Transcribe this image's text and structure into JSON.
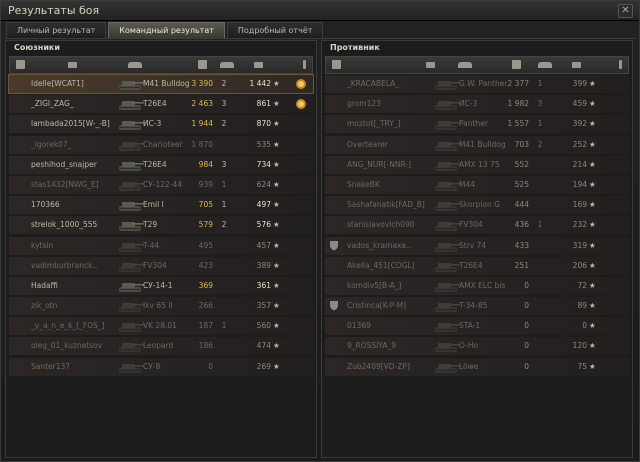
{
  "window": {
    "title": "Результаты боя",
    "close": "✕"
  },
  "tabs": [
    {
      "label": "Личный результат",
      "active": false
    },
    {
      "label": "Командный результат",
      "active": true
    },
    {
      "label": "Подробный отчёт",
      "active": false
    }
  ],
  "allies": {
    "title": "Союзники",
    "rows": [
      {
        "name": "Idelle[WCAT1]",
        "tank": "M41 Bulldog",
        "damage": "3 390",
        "kills": "2",
        "xp": "1 442",
        "medal": true,
        "mine": true,
        "dead": false
      },
      {
        "name": "_ZIGI_ZAG_",
        "tank": "T26E4",
        "damage": "2 463",
        "kills": "3",
        "xp": "861",
        "medal": true,
        "mine": false,
        "dead": false
      },
      {
        "name": "lambada2015[W-_-B]",
        "tank": "ИС-3",
        "damage": "1 944",
        "kills": "2",
        "xp": "870",
        "medal": false,
        "mine": false,
        "dead": false
      },
      {
        "name": "_lgorek07_",
        "tank": "Charioteer",
        "damage": "1 870",
        "kills": "",
        "xp": "535",
        "medal": false,
        "mine": false,
        "dead": true
      },
      {
        "name": "peshihod_snajper",
        "tank": "T26E4",
        "damage": "984",
        "kills": "3",
        "xp": "734",
        "medal": false,
        "mine": false,
        "dead": false
      },
      {
        "name": "stas1432[NWG_E]",
        "tank": "СУ-122-44",
        "damage": "939",
        "kills": "1",
        "xp": "624",
        "medal": false,
        "mine": false,
        "dead": true
      },
      {
        "name": "170366",
        "tank": "Emil I",
        "damage": "705",
        "kills": "1",
        "xp": "497",
        "medal": false,
        "mine": false,
        "dead": false
      },
      {
        "name": "strelok_1000_555",
        "tank": "T29",
        "damage": "579",
        "kills": "2",
        "xp": "576",
        "medal": false,
        "mine": false,
        "dead": false
      },
      {
        "name": "kytsin",
        "tank": "T-44",
        "damage": "495",
        "kills": "",
        "xp": "457",
        "medal": false,
        "mine": false,
        "dead": true
      },
      {
        "name": "vadimburbranck..",
        "tank": "FV304",
        "damage": "423",
        "kills": "",
        "xp": "389",
        "medal": false,
        "mine": false,
        "dead": true
      },
      {
        "name": "Hadaffi",
        "tank": "СУ-14-1",
        "damage": "369",
        "kills": "",
        "xp": "361",
        "medal": false,
        "mine": false,
        "dead": false
      },
      {
        "name": "zik_otn",
        "tank": "Ikv 65 II",
        "damage": "266",
        "kills": "",
        "xp": "357",
        "medal": false,
        "mine": false,
        "dead": true
      },
      {
        "name": "_y_a_n_e_k_[_FOS_]",
        "tank": "VK 28.01",
        "damage": "187",
        "kills": "1",
        "xp": "560",
        "medal": false,
        "mine": false,
        "dead": true
      },
      {
        "name": "oleg_01_kuznetsov",
        "tank": "Leopard",
        "damage": "186",
        "kills": "",
        "xp": "474",
        "medal": false,
        "mine": false,
        "dead": true
      },
      {
        "name": "Santer137",
        "tank": "СУ-8",
        "damage": "0",
        "kills": "",
        "xp": "269",
        "medal": false,
        "mine": false,
        "dead": true
      }
    ]
  },
  "enemies": {
    "title": "Противник",
    "rows": [
      {
        "name": "_KRACABELA_",
        "tank": "G.W. Panther",
        "damage": "2 377",
        "kills": "1",
        "xp": "399",
        "shield": false,
        "dead": true
      },
      {
        "name": "grom123",
        "tank": "ИС-3",
        "damage": "1 982",
        "kills": "3",
        "xp": "459",
        "shield": false,
        "dead": true
      },
      {
        "name": "moztot[_TRY_]",
        "tank": "Panther",
        "damage": "1 557",
        "kills": "1",
        "xp": "392",
        "shield": false,
        "dead": true
      },
      {
        "name": "Overtearer",
        "tank": "M41 Bulldog",
        "damage": "703",
        "kills": "2",
        "xp": "252",
        "shield": false,
        "dead": true
      },
      {
        "name": "ANG_NUR[-NNR-]",
        "tank": "AMX 13 75",
        "damage": "552",
        "kills": "",
        "xp": "214",
        "shield": false,
        "dead": true
      },
      {
        "name": "SnakeBK",
        "tank": "M44",
        "damage": "525",
        "kills": "",
        "xp": "194",
        "shield": false,
        "dead": true
      },
      {
        "name": "Sashafanatik[FAD_B]",
        "tank": "Skorpion G",
        "damage": "444",
        "kills": "",
        "xp": "169",
        "shield": false,
        "dead": true
      },
      {
        "name": "stanislavovich090",
        "tank": "FV304",
        "damage": "436",
        "kills": "1",
        "xp": "232",
        "shield": false,
        "dead": true
      },
      {
        "name": "vados_kramaxa..",
        "tank": "Strv 74",
        "damage": "433",
        "kills": "",
        "xp": "319",
        "shield": true,
        "dead": true
      },
      {
        "name": "Akella_451[COGL]",
        "tank": "T26E4",
        "damage": "251",
        "kills": "",
        "xp": "206",
        "shield": false,
        "dead": true
      },
      {
        "name": "komdiv5[B-A_]",
        "tank": "AMX ELC bis",
        "damage": "0",
        "kills": "",
        "xp": "72",
        "shield": false,
        "dead": true
      },
      {
        "name": "Cristinca[K-P-M]",
        "tank": "T-34-85",
        "damage": "0",
        "kills": "",
        "xp": "89",
        "shield": true,
        "dead": true
      },
      {
        "name": "01369",
        "tank": "STA-1",
        "damage": "0",
        "kills": "",
        "xp": "0",
        "shield": false,
        "dead": true
      },
      {
        "name": "9_ROSSIYA_9",
        "tank": "O-Ho",
        "damage": "0",
        "kills": "",
        "xp": "120",
        "shield": false,
        "dead": true
      },
      {
        "name": "Zub2409[VD-ZP]",
        "tank": "Löwe",
        "damage": "0",
        "kills": "",
        "xp": "75",
        "shield": false,
        "dead": true
      }
    ]
  },
  "colors": {
    "accent": "#6a5638",
    "gold": "#e0b84a"
  }
}
